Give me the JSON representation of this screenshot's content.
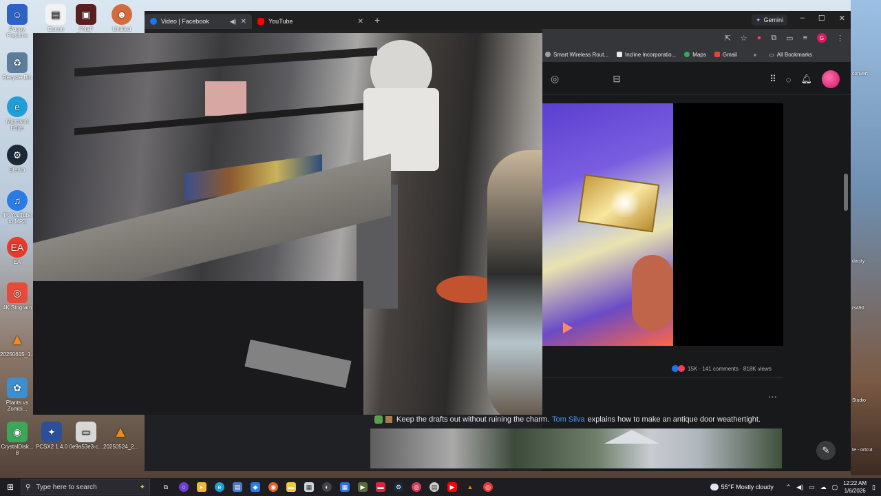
{
  "desktop": {
    "left_icons": [
      {
        "label": "Poppy Playtime",
        "icon": "poppy-icon",
        "color": "#2d62c6"
      },
      {
        "label": "Recycle Bin",
        "icon": "recycle-bin-icon",
        "color": "#5d7d9d"
      },
      {
        "label": "Microsoft Edge",
        "icon": "edge-icon",
        "color": "#1f9ed8"
      },
      {
        "label": "Steam",
        "icon": "steam-icon",
        "color": "#1b2838"
      },
      {
        "label": "4K YouTube to MP3",
        "icon": "youtube-mp3-icon",
        "color": "#2b7be4"
      },
      {
        "label": "EA",
        "icon": "ea-icon",
        "color": "#e73a2a"
      },
      {
        "label": "4K Stogram",
        "icon": "stogram-icon",
        "color": "#e84a3a"
      },
      {
        "label": "20250615_1...",
        "icon": "vlc-icon",
        "color": "#f08a1a"
      },
      {
        "label": "Plants vs Zombi...",
        "icon": "pvz-icon",
        "color": "#3d8fcf"
      },
      {
        "label": "CrystalDisk... 8",
        "icon": "crystaldisk-icon",
        "color": "#3aa858"
      }
    ],
    "top_icons": [
      {
        "label": "Canon",
        "icon": "canon-icon"
      },
      {
        "label": "FNaF Rated...",
        "icon": "fnaf-icon"
      },
      {
        "label": "Untitled",
        "icon": "untitled-icon"
      }
    ],
    "bottom_icons": [
      {
        "label": "PCSX2 1.4.0",
        "icon": "pcsx2-icon"
      },
      {
        "label": "0e9a53e3-c...",
        "icon": "file-icon"
      },
      {
        "label": "20250524_2...",
        "icon": "vlc-icon"
      }
    ],
    "right_labels": [
      "convert",
      "dacity",
      "rs490",
      "Studio",
      "te - ortcut"
    ]
  },
  "browser": {
    "tabs": [
      {
        "title": "Video | Facebook",
        "favicon_color": "#1877f2",
        "active": true
      },
      {
        "title": "YouTube",
        "favicon_color": "#ff0000",
        "active": false
      }
    ],
    "new_tab": "+",
    "gemini_label": "Gemini",
    "window_controls": {
      "minimize": "–",
      "maximize": "☐",
      "close": "✕"
    },
    "profile_initial": "G",
    "bookmarks": [
      {
        "label": "Smart Wireless Rout..."
      },
      {
        "label": "Incline Incorporatio..."
      },
      {
        "label": "Maps"
      },
      {
        "label": "Gmail"
      }
    ],
    "bookmarks_more": "»",
    "all_bookmarks": "All Bookmarks"
  },
  "facebook": {
    "reactions_summary": "15K · 141 comments · 818K views",
    "more_label": "···",
    "caption": {
      "pre": "Keep the drafts out without ruining the charm.",
      "link": "Tom Silva",
      "post": "explains how to make an antique door weathertight."
    },
    "compose_icon": "✎"
  },
  "taskbar": {
    "search_placeholder": "Type here to search",
    "weather": "55°F  Mostly cloudy",
    "time": "12:22 AM",
    "date": "1/6/2026"
  }
}
